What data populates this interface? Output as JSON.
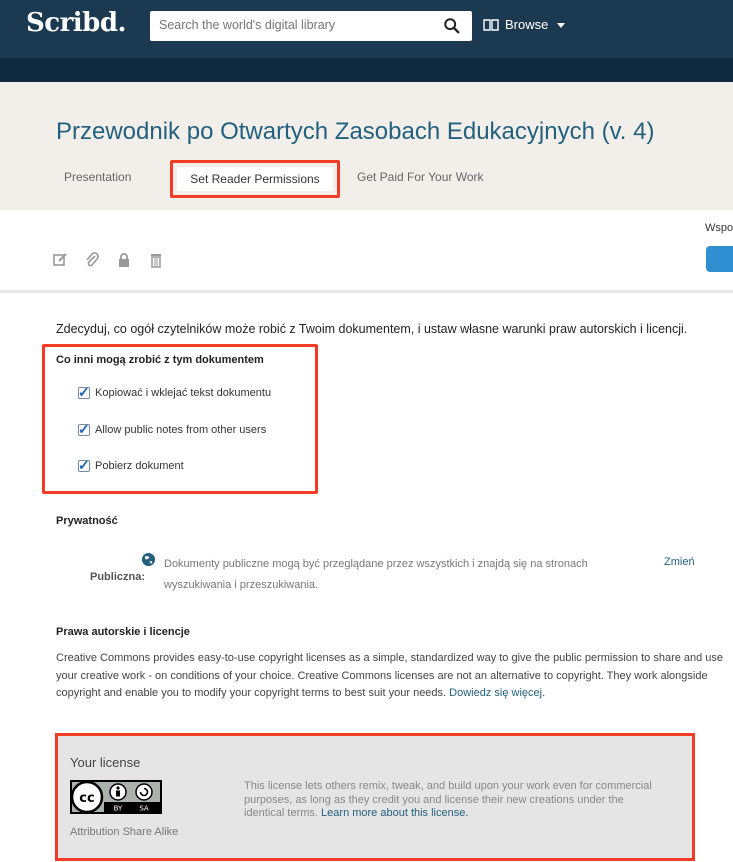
{
  "nav": {
    "logo": "Scribd.",
    "search_placeholder": "Search the world's digital library",
    "browse_label": "Browse"
  },
  "document": {
    "title": "Przewodnik po Otwartych Zasobach Edukacyjnych (v. 4)"
  },
  "tabs": [
    {
      "label": "Presentation"
    },
    {
      "label": "Set Reader Permissions"
    },
    {
      "label": "Get Paid For Your Work"
    }
  ],
  "toolbar": {
    "side_label": "Wspo"
  },
  "intro": "Zdecyduj, co ogół czytelników może robić z Twoim dokumentem, i ustaw własne warunki praw autorskich i licencji.",
  "permissions": {
    "title": "Co inni mogą zrobić z tym dokumentem",
    "items": [
      {
        "label": "Kopiować i wklejać tekst dokumentu",
        "checked": true
      },
      {
        "label": "Allow public notes from other users",
        "checked": true
      },
      {
        "label": "Pobierz dokument",
        "checked": true
      }
    ]
  },
  "privacy": {
    "title": "Prywatność",
    "label": "Publiczna:",
    "text": "Dokumenty publiczne mogą być przeglądane przez wszystkich i znajdą się na stronach wyszukiwania i przeszukiwania.",
    "change": "Zmień"
  },
  "copyright": {
    "title": "Prawa autorskie i licencje",
    "text": "Creative Commons provides easy-to-use copyright licenses as a simple, standardized way to give the public permission to share and use your creative work - on conditions of your choice. Creative Commons licenses are not an alternative to copyright. They work alongside copyright and enable you to modify your copyright terms to best suit your needs.",
    "link": "Dowiedz się więcej"
  },
  "license": {
    "title": "Your license",
    "badge_left": "BY",
    "badge_right": "SA",
    "name": "Attribution Share Alike",
    "description": "This license lets others remix, tweak, and build upon your work even for commercial purposes, as long as they credit you and license their new creations under the identical terms.",
    "link": "Learn more about this license."
  }
}
